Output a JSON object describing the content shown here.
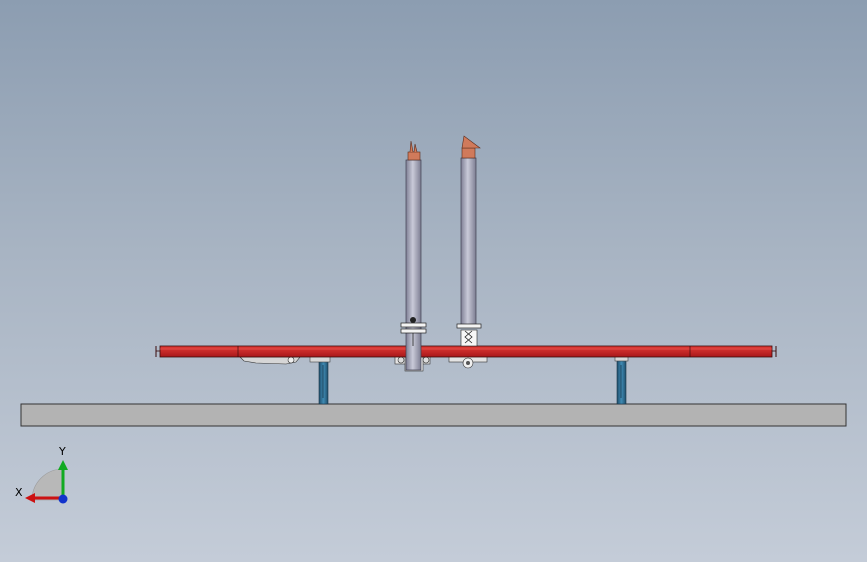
{
  "viewport": {
    "background_top": "#8c9db1",
    "background_bottom": "#c4ccd8"
  },
  "model": {
    "floor_color": "#b3b3b3",
    "beam_color": "#c8201f",
    "pipe_color": "#a9aabd",
    "pipe_tip_color": "#d07a5b",
    "leg_color": "#2d6f94"
  },
  "triad": {
    "x_label": "X",
    "y_label": "Y",
    "x_color": "#cc1111",
    "y_color": "#11aa22",
    "z_color": "#1133cc"
  }
}
